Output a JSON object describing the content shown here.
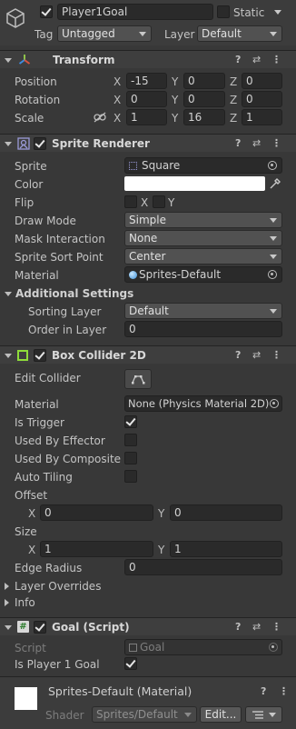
{
  "gameobject": {
    "name": "Player1Goal",
    "active": true,
    "static_label": "Static",
    "static": false,
    "tag_label": "Tag",
    "tag_value": "Untagged",
    "layer_label": "Layer",
    "layer_value": "Default"
  },
  "transform": {
    "title": "Transform",
    "position_label": "Position",
    "rotation_label": "Rotation",
    "scale_label": "Scale",
    "axis_x": "X",
    "axis_y": "Y",
    "axis_z": "Z",
    "position": {
      "x": "-15",
      "y": "0",
      "z": "0"
    },
    "rotation": {
      "x": "0",
      "y": "0",
      "z": "0"
    },
    "scale": {
      "x": "1",
      "y": "16",
      "z": "1"
    }
  },
  "sprite_renderer": {
    "title": "Sprite Renderer",
    "enabled": true,
    "sprite_label": "Sprite",
    "sprite_value": "Square",
    "color_label": "Color",
    "color_value": "#ffffff",
    "flip_label": "Flip",
    "flip_x_label": "X",
    "flip_y_label": "Y",
    "draw_mode_label": "Draw Mode",
    "draw_mode_value": "Simple",
    "mask_label": "Mask Interaction",
    "mask_value": "None",
    "sort_point_label": "Sprite Sort Point",
    "sort_point_value": "Center",
    "material_label": "Material",
    "material_value": "Sprites-Default",
    "additional_label": "Additional Settings",
    "sorting_layer_label": "Sorting Layer",
    "sorting_layer_value": "Default",
    "order_label": "Order in Layer",
    "order_value": "0"
  },
  "box_collider": {
    "title": "Box Collider 2D",
    "enabled": true,
    "edit_label": "Edit Collider",
    "material_label": "Material",
    "material_value": "None (Physics Material 2D)",
    "trigger_label": "Is Trigger",
    "trigger": true,
    "effector_label": "Used By Effector",
    "composite_label": "Used By Composite",
    "tiling_label": "Auto Tiling",
    "offset_label": "Offset",
    "offset": {
      "x": "0",
      "y": "0"
    },
    "size_label": "Size",
    "size": {
      "x": "1",
      "y": "1"
    },
    "edge_label": "Edge Radius",
    "edge_value": "0",
    "layer_overrides_label": "Layer Overrides",
    "info_label": "Info"
  },
  "goal_script": {
    "title": "Goal (Script)",
    "enabled": true,
    "script_label": "Script",
    "script_value": "Goal",
    "player1_label": "Is Player 1 Goal",
    "player1": true
  },
  "material": {
    "title": "Sprites-Default (Material)",
    "shader_label": "Shader",
    "shader_value": "Sprites/Default",
    "edit_label": "Edit..."
  },
  "icons": {
    "help": "?",
    "presets": "⇄",
    "more": "⋮"
  }
}
